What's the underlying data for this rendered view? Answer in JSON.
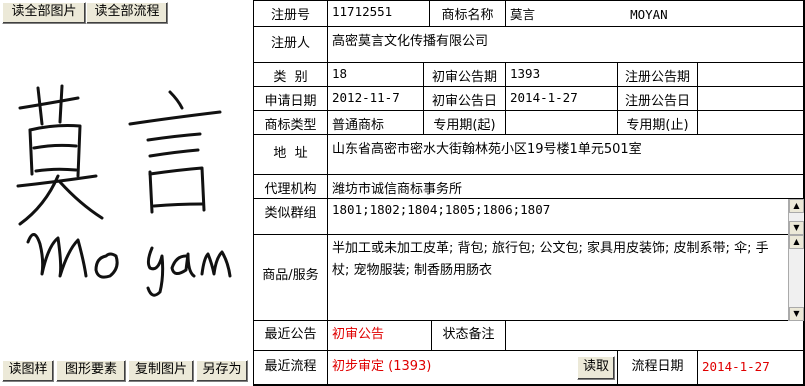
{
  "toolbar": {
    "read_all_images": "读全部图片",
    "read_all_process": "读全部流程"
  },
  "bottom_toolbar": {
    "read_sample": "读图样",
    "graphic_elements": "图形要素",
    "copy_image": "复制图片",
    "save_as": "另存为"
  },
  "logo": {
    "cn_text": "莫言",
    "en_text": "Mo Yan"
  },
  "record": {
    "reg_no_label": "注册号",
    "reg_no": "11712551",
    "mark_name_label": "商标名称",
    "mark_name": "莫言",
    "mark_name_en": "MOYAN",
    "registrant_label": "注册人",
    "registrant": "高密莫言文化传播有限公司",
    "class_label": "类  别",
    "class": "18",
    "prelim_issue_label": "初审公告期",
    "prelim_issue": "1393",
    "reg_issue_label": "注册公告期",
    "reg_issue": "",
    "apply_date_label": "申请日期",
    "apply_date": "2012-11-7",
    "prelim_date_label": "初审公告日",
    "prelim_date": "2014-1-27",
    "reg_date_label": "注册公告日",
    "reg_date": "",
    "mark_type_label": "商标类型",
    "mark_type": "普通商标",
    "exclusive_start_label": "专用期(起)",
    "exclusive_start": "",
    "exclusive_end_label": "专用期(止)",
    "exclusive_end": "",
    "address_label": "地  址",
    "address": "山东省高密市密水大街翰林苑小区19号楼1单元501室",
    "agent_label": "代理机构",
    "agent": "潍坊市诚信商标事务所",
    "similar_groups_label": "类似群组",
    "similar_groups": "1801;1802;1804;1805;1806;1807",
    "goods_label": "商品/服务",
    "goods": "半加工或未加工皮革; 背包; 旅行包; 公文包; 家具用皮装饰; 皮制系带; 伞; 手杖; 宠物服装; 制香肠用肠衣",
    "latest_notice_label": "最近公告",
    "latest_notice": "初审公告",
    "status_note_label": "状态备注",
    "status_note": "",
    "latest_process_label": "最近流程",
    "latest_process": "初步审定 (1393)",
    "read_button": "读取",
    "process_date_label": "流程日期",
    "process_date": "2014-1-27"
  },
  "colors": {
    "button_face": "#ece9d8",
    "highlight_red": "#e00000"
  }
}
